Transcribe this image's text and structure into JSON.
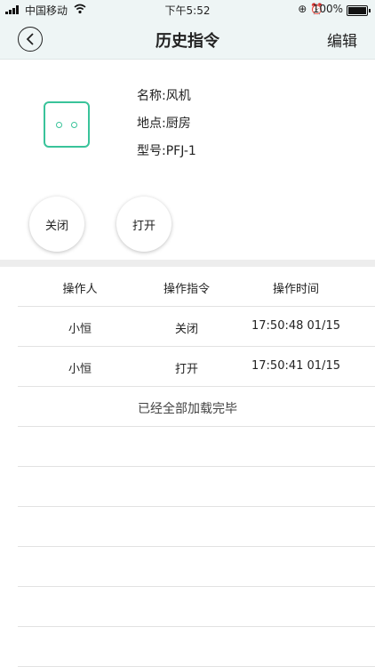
{
  "status": {
    "carrier": "中国移动",
    "time": "下午5:52",
    "battery": "100%"
  },
  "nav": {
    "title": "历史指令",
    "edit": "编辑"
  },
  "device": {
    "name": "名称:风机",
    "location": "地点:厨房",
    "model": "型号:PFJ-1"
  },
  "actions": {
    "close": "关闭",
    "open": "打开"
  },
  "table": {
    "headers": [
      "操作人",
      "操作指令",
      "操作时间"
    ],
    "rows": [
      {
        "user": "小恒",
        "command": "关闭",
        "time": "17:50:48 01/15"
      },
      {
        "user": "小恒",
        "command": "打开",
        "time": "17:50:41 01/15"
      }
    ],
    "footer": "已经全部加载完毕"
  },
  "colors": {
    "accent": "#39c39a",
    "navBackground": "#eef5f5"
  }
}
